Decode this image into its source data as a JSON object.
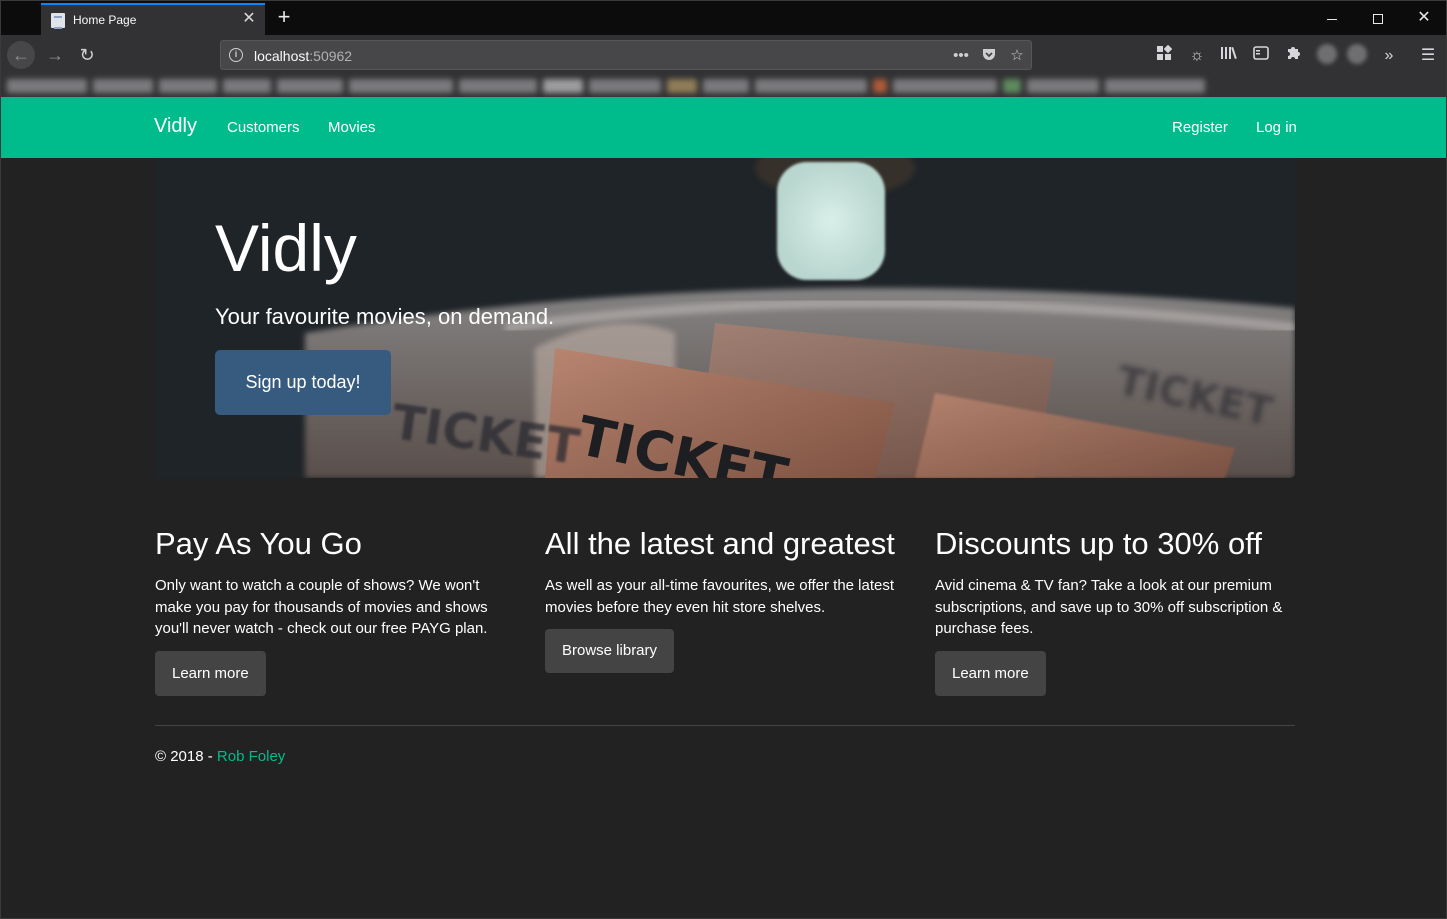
{
  "browser": {
    "tab": {
      "title": "Home Page"
    },
    "url": {
      "host": "localhost",
      "port": ":50962"
    }
  },
  "site": {
    "brand": "Vidly",
    "nav_left": [
      "Customers",
      "Movies"
    ],
    "nav_right": [
      "Register",
      "Log in"
    ],
    "accent_color": "#00bc8c",
    "hero": {
      "title": "Vidly",
      "subtitle": "Your favourite movies, on demand.",
      "button": "Sign up today!",
      "image_text": "TICKET"
    },
    "features": [
      {
        "heading": "Pay As You Go",
        "text": "Only want to watch a couple of shows? We won't make you pay for thousands of movies and shows you'll never watch - check out our free PAYG plan.",
        "button": "Learn more"
      },
      {
        "heading": "All the latest and greatest",
        "text": "As well as your all-time favourites, we offer the latest movies before they even hit store shelves.",
        "button": "Browse library"
      },
      {
        "heading": "Discounts up to 30% off",
        "text": "Avid cinema & TV fan? Take a look at our premium subscriptions, and save up to 30% off subscription & purchase fees.",
        "button": "Learn more"
      }
    ],
    "footer": {
      "copyright": "© 2018 - ",
      "author": "Rob Foley"
    }
  }
}
